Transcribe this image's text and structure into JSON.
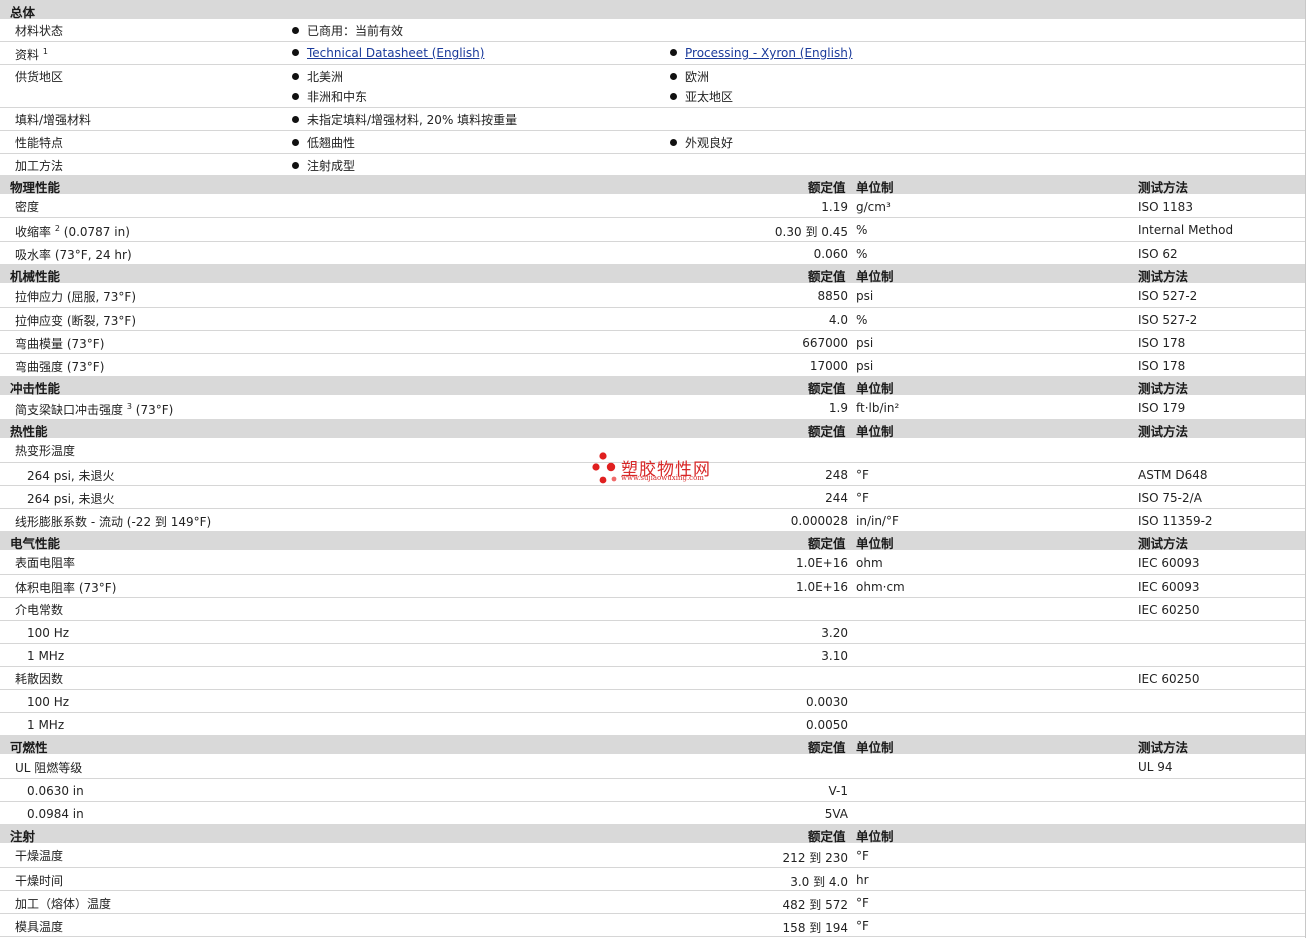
{
  "general": {
    "title": "总体",
    "rows": [
      {
        "label": "材料状态",
        "items": [
          "已商用：当前有效"
        ]
      },
      {
        "label": "资料",
        "sup": "1",
        "links": [
          "Technical Datasheet (English)",
          "Processing - Xyron (English)"
        ]
      },
      {
        "label": "供货地区",
        "items": [
          "北美洲",
          "欧洲",
          "非洲和中东",
          "亚太地区"
        ]
      },
      {
        "label": "填料/增强材料",
        "items": [
          "未指定填料/增强材料, 20% 填料按重量"
        ]
      },
      {
        "label": "性能特点",
        "items": [
          "低翘曲性",
          "外观良好"
        ]
      },
      {
        "label": "加工方法",
        "items": [
          "注射成型"
        ]
      }
    ]
  },
  "headers": {
    "rated": "额定值",
    "unit": "单位制",
    "test": "测试方法"
  },
  "physical": {
    "title": "物理性能",
    "rows": [
      {
        "label": "密度",
        "value": "1.19",
        "unit": "g/cm³",
        "method": "ISO 1183"
      },
      {
        "label": "收缩率",
        "sup": "2",
        "cond": "(0.0787 in)",
        "value": "0.30 到  0.45",
        "unit": "%",
        "method": "Internal Method"
      },
      {
        "label": "吸水率",
        "cond": "(73°F, 24 hr)",
        "value": "0.060",
        "unit": "%",
        "method": "ISO 62"
      }
    ]
  },
  "mechanical": {
    "title": "机械性能",
    "rows": [
      {
        "label": "拉伸应力",
        "cond": "(屈服, 73°F)",
        "value": "8850",
        "unit": "psi",
        "method": "ISO 527-2"
      },
      {
        "label": "拉伸应变",
        "cond": "(断裂, 73°F)",
        "value": "4.0",
        "unit": "%",
        "method": "ISO 527-2"
      },
      {
        "label": "弯曲模量",
        "cond": "(73°F)",
        "value": "667000",
        "unit": "psi",
        "method": "ISO 178"
      },
      {
        "label": "弯曲强度",
        "cond": "(73°F)",
        "value": "17000",
        "unit": "psi",
        "method": "ISO 178"
      }
    ]
  },
  "impact": {
    "title": "冲击性能",
    "rows": [
      {
        "label": "简支梁缺口冲击强度",
        "sup": "3",
        "cond": "(73°F)",
        "value": "1.9",
        "unit": "ft·lb/in²",
        "method": "ISO 179"
      }
    ]
  },
  "thermal": {
    "title": "热性能",
    "rows": [
      {
        "label": "热变形温度"
      },
      {
        "label": "264 psi, 未退火",
        "value": "248",
        "unit": "°F",
        "method": "ASTM D648"
      },
      {
        "label": "264 psi, 未退火",
        "value": "244",
        "unit": "°F",
        "method": "ISO 75-2/A"
      },
      {
        "label": "线形膨胀系数 - 流动",
        "cond": "(-22 到  149°F)",
        "value": "0.000028",
        "unit": "in/in/°F",
        "method": "ISO 11359-2"
      }
    ]
  },
  "electrical": {
    "title": "电气性能",
    "rows": [
      {
        "label": "表面电阻率",
        "value": "1.0E+16",
        "unit": "ohm",
        "method": "IEC 60093"
      },
      {
        "label": "体积电阻率",
        "cond": "(73°F)",
        "value": "1.0E+16",
        "unit": "ohm·cm",
        "method": "IEC 60093"
      },
      {
        "label": "介电常数",
        "method": "IEC 60250"
      },
      {
        "label": "100 Hz",
        "value": "3.20"
      },
      {
        "label": "1 MHz",
        "value": "3.10"
      },
      {
        "label": "耗散因数",
        "method": "IEC 60250"
      },
      {
        "label": "100 Hz",
        "value": "0.0030"
      },
      {
        "label": "1 MHz",
        "value": "0.0050"
      }
    ]
  },
  "flammability": {
    "title": "可燃性",
    "rows": [
      {
        "label": "UL 阻燃等级",
        "method": "UL 94"
      },
      {
        "label": "0.0630 in",
        "value": "V-1"
      },
      {
        "label": "0.0984 in",
        "value": "5VA"
      }
    ]
  },
  "injection": {
    "title": "注射",
    "rows": [
      {
        "label": "干燥温度",
        "value": "212 到  230",
        "unit": "°F"
      },
      {
        "label": "干燥时间",
        "value": "3.0 到  4.0",
        "unit": "hr"
      },
      {
        "label": "加工（熔体）温度",
        "value": "482 到  572",
        "unit": "°F"
      },
      {
        "label": "模具温度",
        "value": "158 到  194",
        "unit": "°F"
      }
    ]
  },
  "watermark": {
    "name": "塑胶物性网",
    "url": "www.sujiaowuxing.com",
    "color": "#d82828"
  }
}
